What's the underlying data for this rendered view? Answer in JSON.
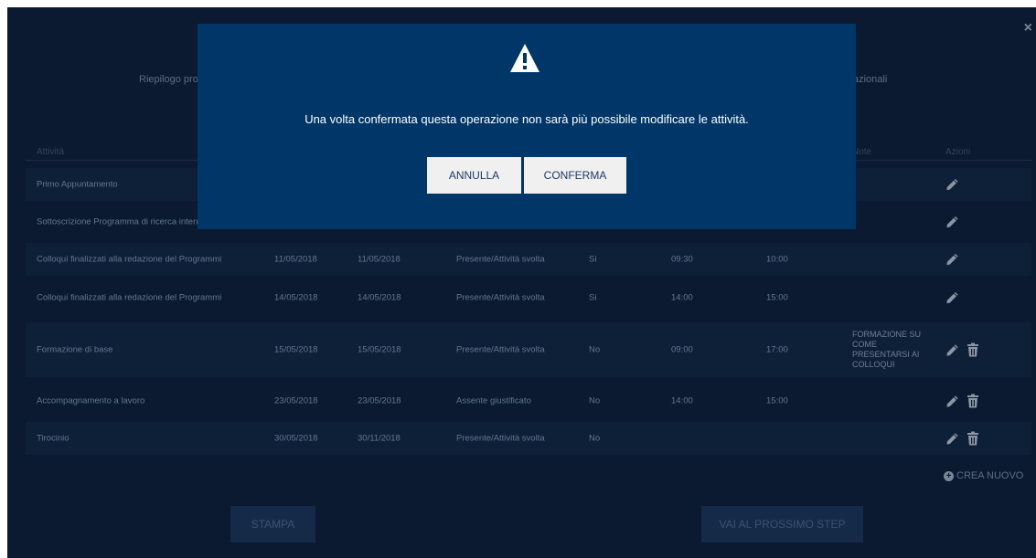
{
  "close_symbol": "×",
  "summary": {
    "left_text": "Riepilogo pro",
    "right_text": "azionali"
  },
  "table": {
    "headers": {
      "activity": "Attività",
      "notes": "Note",
      "actions": "Azioni"
    },
    "rows": [
      {
        "activity": "Primo Appuntamento",
        "date_from": "",
        "date_to": "",
        "status": "",
        "attended": "",
        "time_from": "",
        "time_to": "",
        "note": "",
        "editable": true,
        "deletable": false
      },
      {
        "activity": "Sottoscrizione Programma di ricerca intens",
        "date_from": "",
        "date_to": "",
        "status": "",
        "attended": "",
        "time_from": "",
        "time_to": "",
        "note": "",
        "editable": true,
        "deletable": false
      },
      {
        "activity": "Colloqui finalizzati alla redazione del Programmi",
        "date_from": "11/05/2018",
        "date_to": "11/05/2018",
        "status": "Presente/Attività svolta",
        "attended": "Si",
        "time_from": "09:30",
        "time_to": "10:00",
        "note": "",
        "editable": true,
        "deletable": false
      },
      {
        "activity": "Colloqui finalizzati alla redazione del Programmi",
        "date_from": "14/05/2018",
        "date_to": "14/05/2018",
        "status": "Presente/Attività svolta",
        "attended": "Si",
        "time_from": "14:00",
        "time_to": "15:00",
        "note": "",
        "editable": true,
        "deletable": false
      },
      {
        "activity": "Formazione di base",
        "date_from": "15/05/2018",
        "date_to": "15/05/2018",
        "status": "Presente/Attività svolta",
        "attended": "No",
        "time_from": "09:00",
        "time_to": "17:00",
        "note": "FORMAZIONE SU COME PRESENTARSI AI COLLOQUI",
        "editable": true,
        "deletable": true
      },
      {
        "activity": "Accompagnamento a lavoro",
        "date_from": "23/05/2018",
        "date_to": "23/05/2018",
        "status": "Assente giustificato",
        "attended": "No",
        "time_from": "14:00",
        "time_to": "15:00",
        "note": "",
        "editable": true,
        "deletable": true
      },
      {
        "activity": "Tirocinio",
        "date_from": "30/05/2018",
        "date_to": "30/11/2018",
        "status": "Presente/Attività svolta",
        "attended": "No",
        "time_from": "",
        "time_to": "",
        "note": "",
        "editable": true,
        "deletable": true
      }
    ]
  },
  "create_new_label": "CREA NUOVO",
  "footer": {
    "print_label": "STAMPA",
    "next_label": "VAI AL PROSSIMO STEP"
  },
  "modal": {
    "icon": "warning-icon",
    "message": "Una volta confermata questa operazione non sarà più possibile modificare le attività.",
    "cancel_label": "ANNULLA",
    "confirm_label": "CONFERMA"
  },
  "colors": {
    "background": "#0b1a31",
    "modal": "#003668",
    "modal_button": "#f0f0f0",
    "footer_button": "#142a48"
  }
}
